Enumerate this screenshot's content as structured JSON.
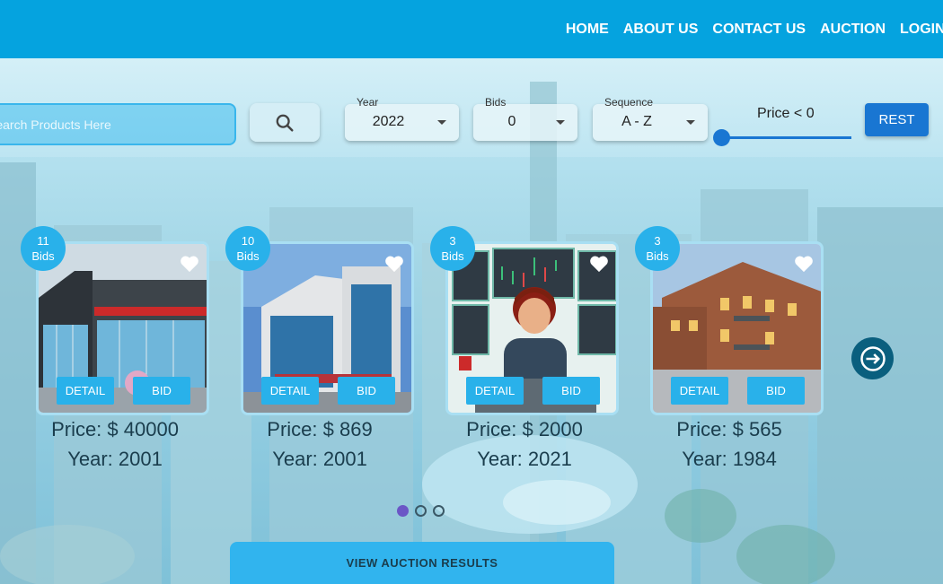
{
  "nav": {
    "items": [
      "HOME",
      "ABOUT US",
      "CONTACT US",
      "AUCTION",
      "LOGIN"
    ]
  },
  "search": {
    "placeholder": "Search Products Here"
  },
  "filters": {
    "year": {
      "label": "Year",
      "value": "2022"
    },
    "bids": {
      "label": "Bids",
      "value": "0"
    },
    "sequence": {
      "label": "Sequence",
      "value": "A - Z"
    }
  },
  "price_filter": {
    "label": "Price < 0",
    "level": 0
  },
  "rest_label": "REST",
  "cards": [
    {
      "bids_count": "11",
      "bids_word": "Bids",
      "detail": "DETAIL",
      "bid": "BID",
      "price": "Price: $ 40000",
      "year": "Year: 2001"
    },
    {
      "bids_count": "10",
      "bids_word": "Bids",
      "detail": "DETAIL",
      "bid": "BID",
      "price": "Price: $ 869",
      "year": "Year: 2001"
    },
    {
      "bids_count": "3",
      "bids_word": "Bids",
      "detail": "DETAIL",
      "bid": "BID",
      "price": "Price: $ 2000",
      "year": "Year: 2021"
    },
    {
      "bids_count": "3",
      "bids_word": "Bids",
      "detail": "DETAIL",
      "bid": "BID",
      "price": "Price: $ 565",
      "year": "Year: 1984"
    }
  ],
  "carousel": {
    "active_page": 1,
    "page_count": 3
  },
  "results_button": "VIEW AUCTION RESULTS",
  "colors": {
    "header": "#05a3df",
    "accent": "#29b1ea",
    "primary": "#1976d2",
    "text": "#1a3d4d"
  },
  "icons": {
    "search": "search-icon",
    "heart": "heart-icon",
    "next": "arrow-right-icon"
  }
}
